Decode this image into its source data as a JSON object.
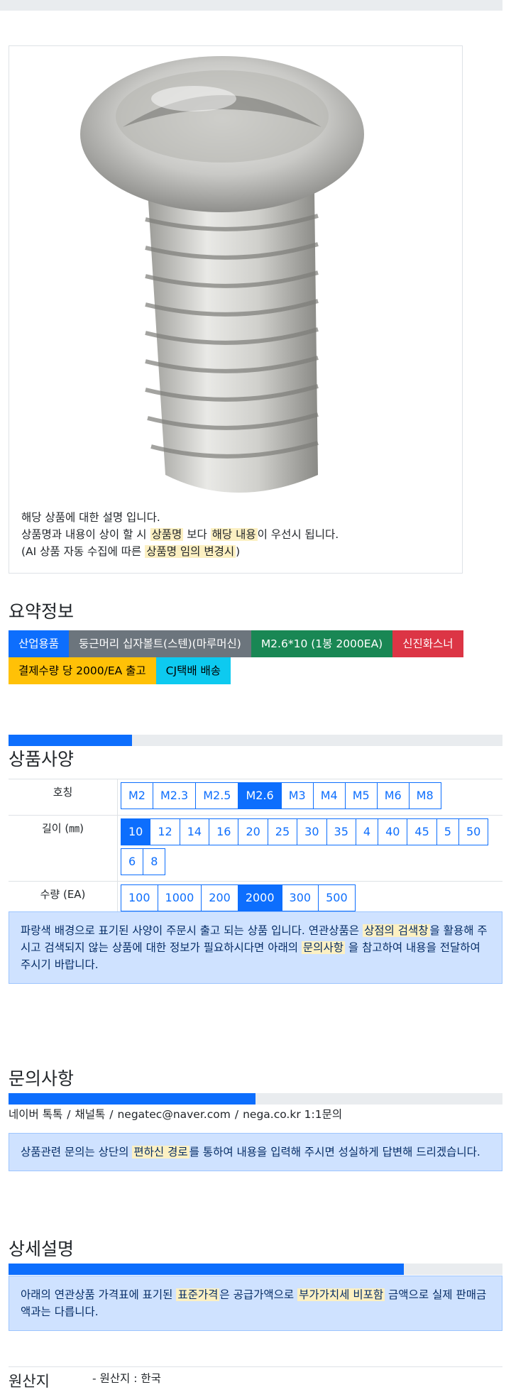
{
  "product": {
    "image_alt": "stainless round-head screw",
    "desc_line1": "해당 상품에 대한 설명 입니다.",
    "desc_line2_a": "상품명과 내용이 상이 할 시 ",
    "desc_line2_mark1": "상품명",
    "desc_line2_b": " 보다 ",
    "desc_line2_mark2": "해당 내용",
    "desc_line2_c": "이 우선시 됩니다.",
    "desc_line3_a": "(AI 상품 자동 수집에 따른 ",
    "desc_line3_mark": "상품명 임의 변경시",
    "desc_line3_b": ")"
  },
  "summary": {
    "title": "요약정보",
    "badges": [
      {
        "label": "산업용품",
        "color": "blue"
      },
      {
        "label": "둥근머리 십자볼트(스텐)(마루머신)",
        "color": "gray"
      },
      {
        "label": "M2.6*10 (1봉 2000EA)",
        "color": "green"
      },
      {
        "label": "신진화스너",
        "color": "red"
      },
      {
        "label": "결제수량 당 2000/EA 출고",
        "color": "yellow"
      },
      {
        "label": "CJ택배 배송",
        "color": "cyan"
      }
    ]
  },
  "spec": {
    "title": "상품사양",
    "progress": 0.25,
    "rows": [
      {
        "label": "호칭",
        "options": [
          "M2",
          "M2.3",
          "M2.5",
          "M2.6",
          "M3",
          "M4",
          "M5",
          "M6",
          "M8"
        ],
        "selected": "M2.6"
      },
      {
        "label": "길이 (㎜)",
        "options": [
          "10",
          "12",
          "14",
          "16",
          "20",
          "25",
          "30",
          "35",
          "4",
          "40",
          "45",
          "5",
          "50",
          "6",
          "8"
        ],
        "selected": "10"
      },
      {
        "label": "수량 (EA)",
        "options": [
          "100",
          "1000",
          "200",
          "2000",
          "300",
          "500"
        ],
        "selected": "2000"
      }
    ],
    "notice_a": "파랑색 배경으로 표기된 사양이 주문시 출고 되는 상품 입니다. 연관상품은 ",
    "notice_mark1": "상점의 검색창",
    "notice_b": "을 활용해 주시고 검색되지 않는 상품에 대한 정보가 필요하시다면 아래의 ",
    "notice_mark2": "문의사항",
    "notice_c": " 을 참고하여 내용을 전달하여 주시기 바랍니다."
  },
  "inquiry": {
    "title": "문의사항",
    "progress": 0.5,
    "channels": [
      "네이버 톡톡",
      "채널톡",
      "negatec@naver.com",
      "nega.co.kr 1:1문의"
    ],
    "separator": "/",
    "notice_a": "상품관련 문의는 상단의 ",
    "notice_mark": "편하신 경로",
    "notice_b": "를 통하여 내용을 입력해 주시면 성실하게 답변해 드리겠습니다."
  },
  "detail": {
    "title": "상세설명",
    "progress": 0.8,
    "notice_a": "아래의 연관상품 가격표에 표기된 ",
    "notice_mark1": "표준가격",
    "notice_b": "은 공급가액으로 ",
    "notice_mark2": "부가가치세 비포함",
    "notice_c": " 금액으로 실제 판매금액과는 다릅니다."
  },
  "origin": {
    "label": "원산지",
    "value": "- 원산지 : 한국"
  },
  "colors": {
    "primary": "#0d6efd",
    "alert_bg": "#cfe2ff",
    "mark_bg": "#fcf0c2"
  }
}
